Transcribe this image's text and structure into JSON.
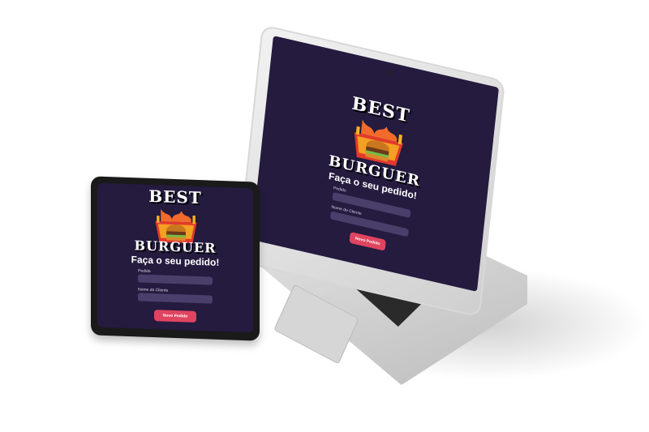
{
  "app": {
    "logo_top": "BEST",
    "logo_bottom": "BURGUER",
    "heading": "Faça o seu pedido!",
    "order_label": "Pedido",
    "order_placeholder": "",
    "client_label": "Nome do Cliente",
    "client_placeholder": "",
    "submit_label": "Novo Pedido"
  },
  "colors": {
    "background": "#241b3f",
    "input": "#4a3f6b",
    "button": "#e0445f",
    "logo_red": "#e23a2b",
    "logo_yellow": "#f7b322"
  },
  "devices": {
    "laptop": "laptop-icon",
    "tablet": "tablet-icon"
  }
}
